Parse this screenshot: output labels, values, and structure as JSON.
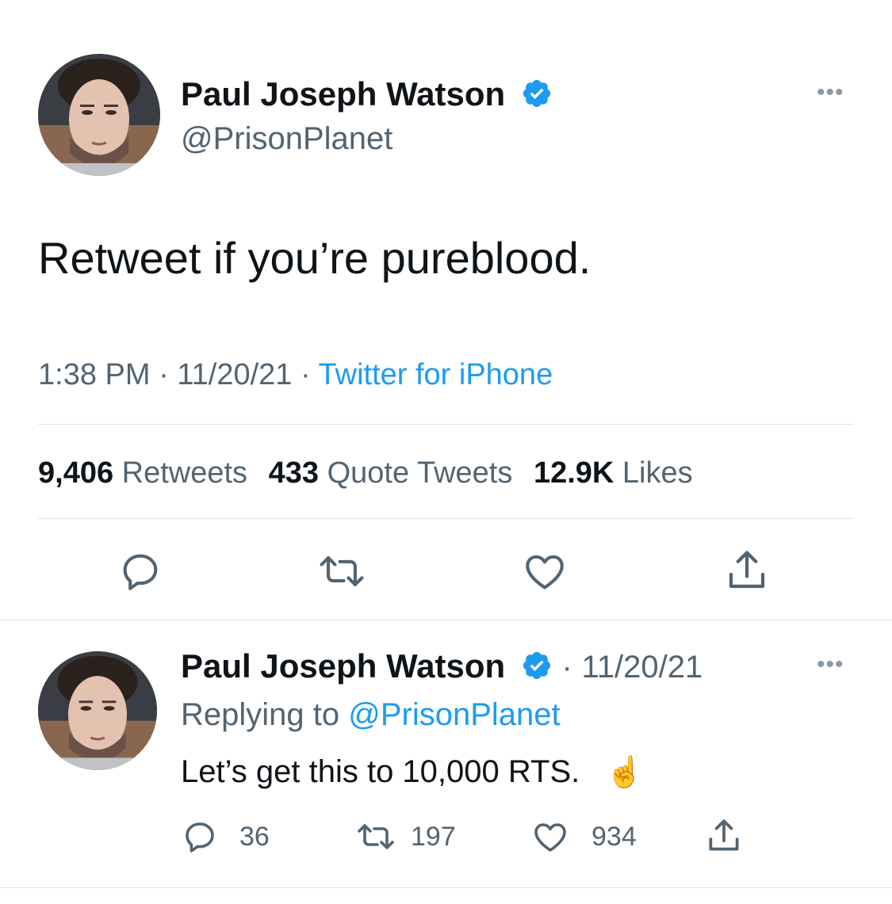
{
  "main_tweet": {
    "author_name": "Paul Joseph Watson",
    "author_handle": "@PrisonPlanet",
    "more_label": "•••",
    "text": "Retweet if you’re pureblood.",
    "time": "1:38 PM",
    "sep1": "·",
    "date": "11/20/21",
    "sep2": "·",
    "source": "Twitter for iPhone",
    "stats": {
      "retweets_count": "9,406",
      "retweets_label": "Retweets",
      "quotes_count": "433",
      "quotes_label": "Quote Tweets",
      "likes_count": "12.9K",
      "likes_label": "Likes"
    },
    "actions": [
      "reply-icon",
      "retweet-icon",
      "like-icon",
      "share-icon"
    ]
  },
  "reply_tweet": {
    "author_name": "Paul Joseph Watson",
    "sep": "·",
    "date": "11/20/21",
    "more_label": "•••",
    "replying_prefix": "Replying to",
    "replying_handle": "@PrisonPlanet",
    "text": "Let’s get this to 10,000 RTS.",
    "emoji": "☝️",
    "reply_count": "36",
    "retweet_count": "197",
    "like_count": "934"
  },
  "colors": {
    "accent": "#1d9bf0",
    "text": "#0f1419",
    "muted": "#536471",
    "divider": "#dfe3e6"
  }
}
